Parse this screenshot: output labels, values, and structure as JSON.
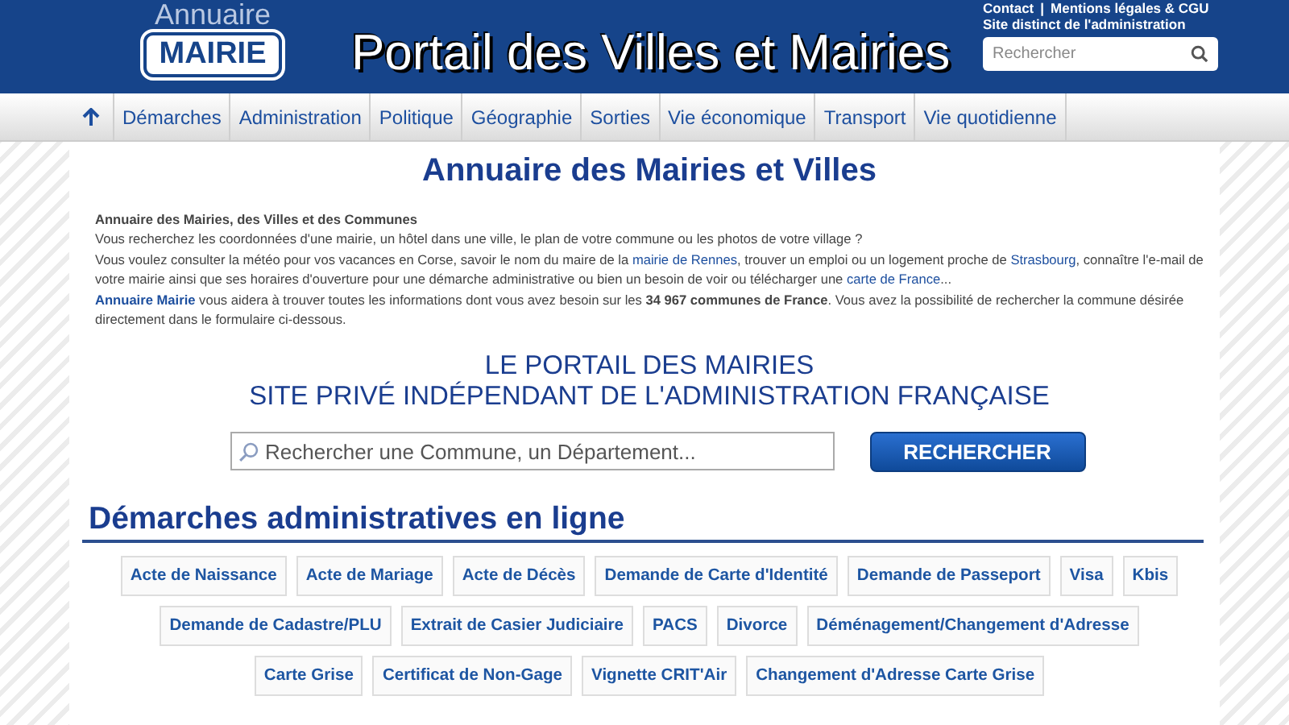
{
  "header": {
    "logo_top": "Annuaire",
    "logo_box": "MAIRIE",
    "title": "Portail des Villes et Mairies",
    "links": [
      "Contact",
      "Mentions légales & CGU"
    ],
    "link_separator": "|",
    "notice": "Site distinct de l'administration",
    "search": {
      "placeholder": "Rechercher"
    }
  },
  "nav": [
    "Démarches",
    "Administration",
    "Politique",
    "Géographie",
    "Sorties",
    "Vie économique",
    "Transport",
    "Vie quotidienne"
  ],
  "page_title": "Annuaire des Mairies et Villes",
  "intro": {
    "heading": "Annuaire des Mairies, des Villes et des Communes",
    "paragraphs": [
      [
        {
          "kind": "text",
          "text": "Vous recherchez les coordonnées d'une mairie, un hôtel dans une ville, le plan de votre commune ou les photos de votre village ?"
        }
      ],
      [
        {
          "kind": "text",
          "text": "Vous voulez consulter la météo pour vos vacances en Corse, savoir le nom du maire de la "
        },
        {
          "kind": "link",
          "text": "mairie de Rennes"
        },
        {
          "kind": "text",
          "text": ", trouver un emploi ou un logement proche de "
        },
        {
          "kind": "link",
          "text": "Strasbourg"
        },
        {
          "kind": "text",
          "text": ", connaître l'e-mail de votre mairie ainsi que ses horaires d'ouverture pour une démarche administrative ou bien un besoin de voir ou télécharger une "
        },
        {
          "kind": "link",
          "text": "carte de France"
        },
        {
          "kind": "text",
          "text": "..."
        }
      ],
      [
        {
          "kind": "strong-link",
          "text": "Annuaire Mairie"
        },
        {
          "kind": "text",
          "text": " vous aidera à trouver toutes les informations dont vous avez besoin sur les **34 967 communes de France**. Vous avez la possibilité de rechercher la commune désirée directement dans le formulaire ci-dessous."
        }
      ]
    ]
  },
  "banner": [
    "LE PORTAIL DES MAIRIES",
    "SITE PRIVÉ INDÉPENDANT DE L'ADMINISTRATION FRANÇAISE"
  ],
  "commune_search": {
    "placeholder": "Rechercher une Commune, un Département...",
    "button": "RECHERCHER"
  },
  "section_title": "Démarches administratives en ligne",
  "demarches": [
    {
      "items": [
        "Acte de Naissance",
        "Acte de Mariage",
        "Acte de Décès",
        "Demande de Carte d'Identité",
        "Demande de Passeport",
        "Visa",
        "Kbis"
      ]
    },
    {
      "items": [
        "Demande de Cadastre/PLU",
        "Extrait de Casier Judiciaire",
        "PACS",
        "Divorce",
        "Déménagement/Changement d'Adresse"
      ]
    },
    {
      "items": [
        "Carte Grise",
        "Certificat de Non-Gage",
        "Vignette CRIT'Air",
        "Changement d'Adresse Carte Grise"
      ]
    }
  ]
}
